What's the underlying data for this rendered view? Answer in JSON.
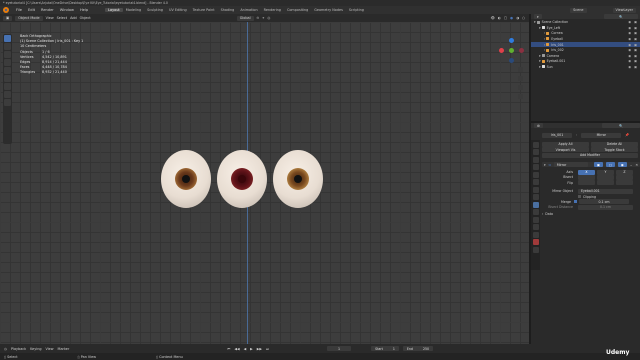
{
  "window": {
    "title": "* eyetutorial4 [C:\\Users\\Arjutai\\OneDrive\\Desktop\\Eye Kit\\Eye_Tutorial\\eyetutorial4.blend] - Blender 4.0"
  },
  "menubar": {
    "items": [
      "File",
      "Edit",
      "Render",
      "Window",
      "Help"
    ],
    "workspaces": [
      "Layout",
      "Modeling",
      "Sculpting",
      "UV Editing",
      "Texture Paint",
      "Shading",
      "Animation",
      "Rendering",
      "Compositing",
      "Geometry Nodes",
      "Scripting"
    ],
    "active_workspace": "Layout",
    "scene": "Scene",
    "view_layer": "ViewLayer"
  },
  "viewport_header": {
    "mode": "Object Mode",
    "menus": [
      "View",
      "Select",
      "Add",
      "Object"
    ],
    "transform_orientation": "Global"
  },
  "viewport": {
    "view_name": "Back Orthographic",
    "collection_line": "(1) Scene Collection | Iris_001 : Key 1",
    "units": "10 Centimeters",
    "stats": [
      {
        "label": "Objects",
        "value": "1 / 6"
      },
      {
        "label": "Vertices",
        "value": "4,542 / 10,891"
      },
      {
        "label": "Edges",
        "value": "8,914 / 21,444"
      },
      {
        "label": "Faces",
        "value": "4,448 / 10,784"
      },
      {
        "label": "Triangles",
        "value": "8,932 / 21,440"
      }
    ],
    "eye_iris_colors": [
      "#6b3a1c",
      "#5e1218",
      "#7a4a20"
    ]
  },
  "outliner": {
    "title": "Scene Collection",
    "rows": [
      {
        "label": "Scene Collection",
        "indent": 0,
        "icon_color": "#9a9a9a",
        "selected": false
      },
      {
        "label": "Eye_Left",
        "indent": 1,
        "icon_color": "#ddd",
        "selected": false
      },
      {
        "label": "Cornea",
        "indent": 2,
        "icon_color": "#e39b3c",
        "selected": false
      },
      {
        "label": "Eyeball",
        "indent": 2,
        "icon_color": "#e39b3c",
        "selected": false
      },
      {
        "label": "Iris_001",
        "indent": 2,
        "icon_color": "#e39b3c",
        "selected": true
      },
      {
        "label": "Iris_002",
        "indent": 2,
        "icon_color": "#e39b3c",
        "selected": false
      },
      {
        "label": "Camera",
        "indent": 1,
        "icon_color": "#9a9a9a",
        "selected": false
      },
      {
        "label": "Eyeball.001",
        "indent": 1,
        "icon_color": "#e39b3c",
        "selected": false
      },
      {
        "label": "Sun",
        "indent": 1,
        "icon_color": "#ddd",
        "selected": false
      }
    ]
  },
  "properties": {
    "object_name": "Iris_001",
    "modifier_tab": "Mirror",
    "apply_all": "Apply All",
    "delete_all": "Delete All",
    "viewport_vis": "Viewport Vis",
    "toggle_stack": "Toggle Stack",
    "add_modifier": "Add Modifier",
    "modifier_name": "Mirror",
    "axis_label": "Axis",
    "axis": [
      "X",
      "Y",
      "Z"
    ],
    "bisect_label": "Bisect",
    "flip_label": "Flip",
    "mirror_object_label": "Mirror Object",
    "mirror_object": "Eyeball.001",
    "clipping_label": "Clipping",
    "merge_label": "Merge",
    "merge_value": "0.1 cm",
    "bisect_distance_label": "Bisect Distance",
    "bisect_distance_value": "0.1 cm",
    "data_label": "Data"
  },
  "timeline": {
    "menus": [
      "Playback",
      "Keying",
      "View",
      "Marker"
    ],
    "current_frame": "1",
    "start_label": "Start",
    "start": "1",
    "end_label": "End",
    "end": "250"
  },
  "statusbar": {
    "items": [
      "Select",
      "Pan View",
      "Context Menu"
    ]
  },
  "watermark": "Udemy",
  "colors": {
    "accent_blue": "#4772b3",
    "selection": "#334d80",
    "object_orange": "#e39b3c"
  }
}
